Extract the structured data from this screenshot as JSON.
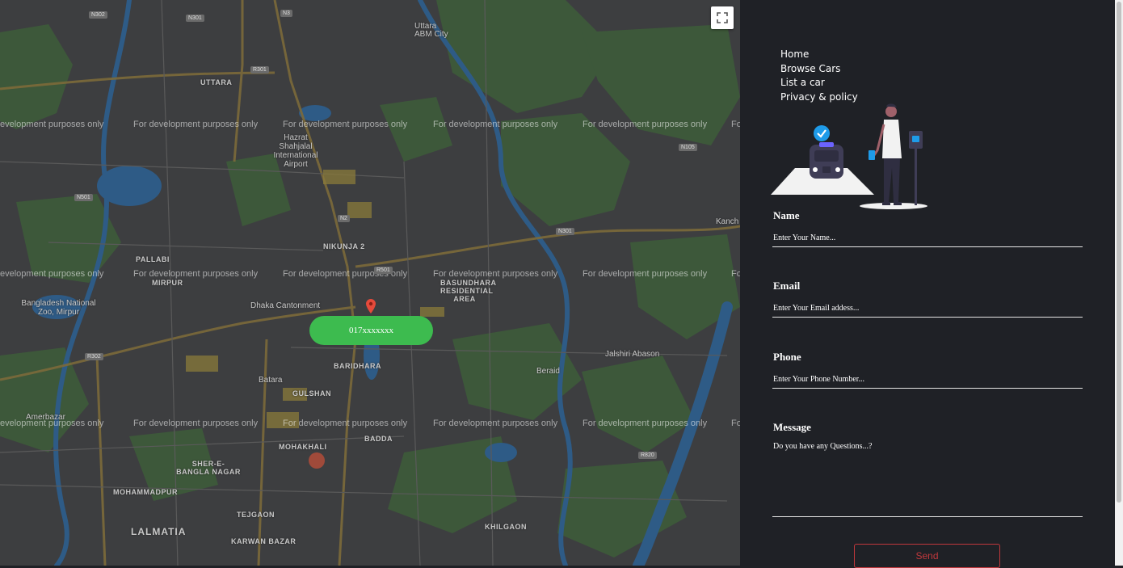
{
  "map": {
    "watermark": "For development purposes only",
    "watermark_partial_left": "evelopment purposes only",
    "watermark_partial_right": "Fo",
    "phone_label": "017xxxxxxx",
    "places": {
      "uttara": "UTTARA",
      "uttara_abm": "Uttara ABM City",
      "airport": "Hazrat Shahjalal International Airport",
      "nikunja": "NIKUNJA 2",
      "pallabi": "PALLABI",
      "mirpur": "MIRPUR",
      "zoo": "Bangladesh National Zoo, Mirpur",
      "cantonment": "Dhaka Cantonment",
      "bashundhara": "BASUNDHARA RESIDENTIAL AREA",
      "baridhara": "BARIDHARA",
      "gulshan": "GULSHAN",
      "badda": "BADDA",
      "moharhali": "MOHAKHALI",
      "sher_e_bangla": "SHER-E-BANGLA NAGAR",
      "mohammadpur": "MOHAMMADPUR",
      "tejgaon": "TEJGAON",
      "lalmatia": "LALMATIA",
      "karwan": "KARWAN BAZAR",
      "khilgaon": "KHILGAON",
      "jalshiri": "Jalshiri Abason",
      "beraid": "Beraid",
      "batara": "Batara",
      "kanch": "Kanch",
      "amerbazar": "Amerbazar"
    },
    "shields": [
      "N302",
      "N301",
      "R301",
      "N3",
      "N105",
      "N501",
      "R501",
      "N2",
      "N301",
      "R302",
      "R820"
    ]
  },
  "nav": {
    "items": [
      "Home",
      "Browse Cars",
      "List a car",
      "Privacy & policy"
    ]
  },
  "form": {
    "name_label": "Name",
    "name_placeholder": "Enter Your Name...",
    "email_label": "Email",
    "email_placeholder": "Enter Your Email addess...",
    "phone_label": "Phone",
    "phone_placeholder": "Enter Your Phone Number...",
    "message_label": "Message",
    "message_placeholder": "Do you have any Questions...?",
    "send_label": "Send"
  },
  "colors": {
    "panel_bg": "#1f2126",
    "send_accent": "#c0383c",
    "bubble_green": "#3dbb4f",
    "pin_red": "#e64a3b"
  },
  "icons": {
    "fullscreen": "fullscreen-icon",
    "pin": "map-pin-icon"
  }
}
